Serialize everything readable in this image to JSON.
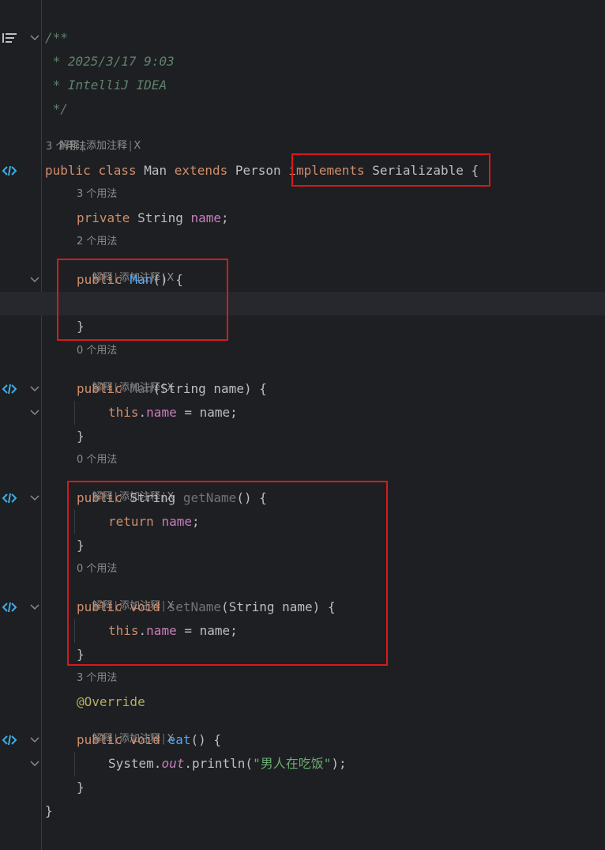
{
  "gutter": {
    "structure_icon": "structure-icon",
    "fold_icon": "chevron-down-icon",
    "implementation_icon": "implementation-icon"
  },
  "doc_comment": {
    "open": "/**",
    "date": " * 2025/3/17 9:03",
    "ide": " * IntelliJ IDEA",
    "close": " */"
  },
  "hints": {
    "explain": "解释",
    "add_comment": "添加注释",
    "close": "X",
    "usages_3": "3 个用法",
    "usages_2": "2 个用法",
    "usages_0": "0 个用法"
  },
  "code": {
    "kw_public": "public",
    "kw_class": "class",
    "kw_extends": "extends",
    "kw_implements": "implements",
    "kw_private": "private",
    "kw_void": "void",
    "kw_this": "this",
    "kw_return": "return",
    "class_name": "Man",
    "parent_class": "Person",
    "interface": "Serializable",
    "type_string": "String",
    "field_name": "name",
    "param": "String name",
    "getter": "getName",
    "setter": "setName",
    "eat": "eat",
    "override": "@Override",
    "system": "System",
    "out": "out",
    "println": "println",
    "string_literal": "\"男人在吃饭\"",
    "open_brace": "{",
    "close_brace": "}",
    "semicolon": ";",
    "empty_parens": "()",
    "dot": ".",
    "assign": " = ",
    "paren_open": "(",
    "paren_close": ")"
  }
}
